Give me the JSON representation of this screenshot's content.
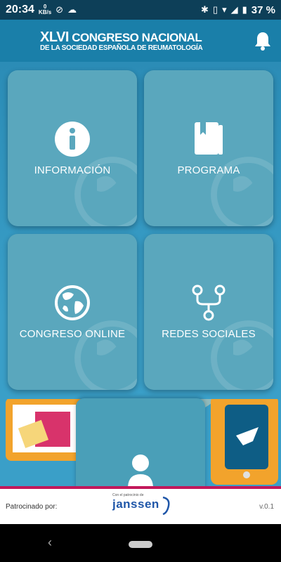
{
  "status_bar": {
    "time": "20:34",
    "data_rate_value": "0",
    "data_rate_unit": "KB/s",
    "battery": "37 %"
  },
  "header": {
    "logo_line1_prefix": "XLVI",
    "logo_line1": "CONGRESO NACIONAL",
    "logo_line2": "DE LA SOCIEDAD ESPAÑOLA DE REUMATOLOGÍA",
    "notification_icon": "bell-icon"
  },
  "tiles": [
    {
      "label": "INFORMACIÓN",
      "icon": "info-icon"
    },
    {
      "label": "PROGRAMA",
      "icon": "book-icon"
    },
    {
      "label": "CONGRESO ONLINE",
      "icon": "globe-icon"
    },
    {
      "label": "REDES SOCIALES",
      "icon": "share-network-icon"
    }
  ],
  "profile_tile": {
    "icon": "user-icon"
  },
  "footer": {
    "sponsored_by": "Patrocinado por:",
    "sponsor_small_text": "Con el patrocinio de",
    "sponsor_name": "janssen",
    "version": "v.0.1"
  },
  "colors": {
    "background": "#2a8fb8",
    "tile": "#5aa7bd",
    "accent_border": "#c2185b",
    "status_bar": "#0d3f58"
  }
}
